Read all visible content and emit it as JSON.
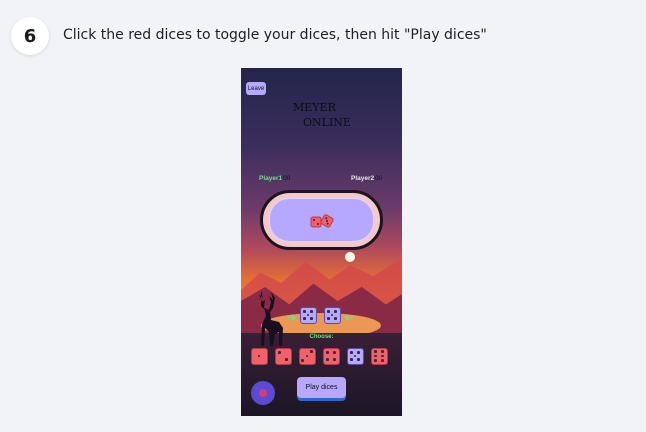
{
  "step": {
    "number": "6",
    "text": "Click the red dices to toggle your dices, then hit \"Play dices\""
  },
  "game": {
    "leave_label": "Leave",
    "title_line1": "MEYER",
    "title_line2": "ONLINE",
    "player1": {
      "name": "Player1",
      "score": "00"
    },
    "player2": {
      "name": "Player2",
      "score": "00"
    },
    "choose_label": "Choose:",
    "play_label": "Play dices",
    "selected_dice": [
      5,
      5
    ],
    "hand_dice": [
      1,
      2,
      3,
      4,
      5,
      6
    ],
    "colors": {
      "accent": "#b7a8ff",
      "die_red": "#f2606a",
      "green": "#6de08a",
      "mic": "#5a4ad6"
    }
  }
}
